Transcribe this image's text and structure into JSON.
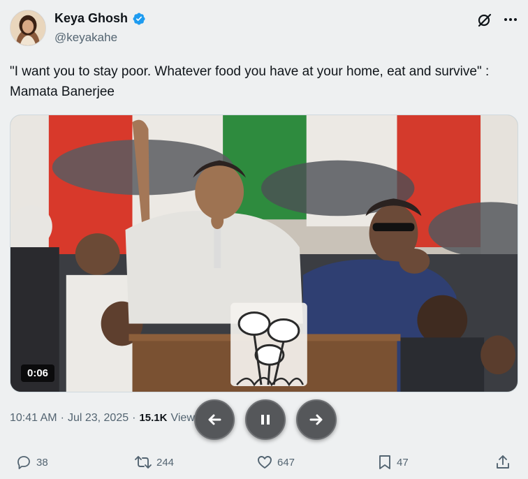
{
  "author": {
    "display_name": "Keya Ghosh",
    "handle": "@keyakahe",
    "verified": true,
    "verified_color": "#1d9bf0"
  },
  "header_actions": {
    "grok_icon": "grok-icon",
    "more_icon": "more-icon"
  },
  "tweet": {
    "text": "\"I want you to stay poor. Whatever food you have at your home, eat and survive\" : Mamata Banerjee"
  },
  "media": {
    "type": "video",
    "duration": "0:06"
  },
  "meta": {
    "time": "10:41 AM",
    "separator": "·",
    "date": "Jul 23, 2025",
    "separator2": "·",
    "views_count": "15.1K",
    "views_label": "Views"
  },
  "player_controls": {
    "back_icon": "arrow-left-icon",
    "pause_icon": "pause-icon",
    "forward_icon": "arrow-right-icon"
  },
  "actions": {
    "replies": "38",
    "reposts": "244",
    "likes": "647",
    "bookmarks": "47"
  }
}
